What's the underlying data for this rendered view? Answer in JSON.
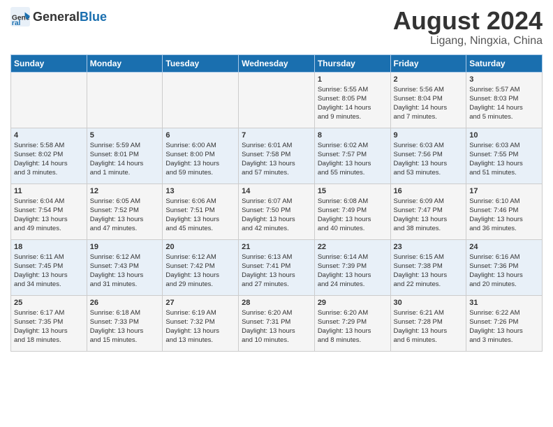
{
  "header": {
    "logo_general": "General",
    "logo_blue": "Blue",
    "month_year": "August 2024",
    "location": "Ligang, Ningxia, China"
  },
  "days_of_week": [
    "Sunday",
    "Monday",
    "Tuesday",
    "Wednesday",
    "Thursday",
    "Friday",
    "Saturday"
  ],
  "weeks": [
    [
      {
        "day": "",
        "info": ""
      },
      {
        "day": "",
        "info": ""
      },
      {
        "day": "",
        "info": ""
      },
      {
        "day": "",
        "info": ""
      },
      {
        "day": "1",
        "info": "Sunrise: 5:55 AM\nSunset: 8:05 PM\nDaylight: 14 hours\nand 9 minutes."
      },
      {
        "day": "2",
        "info": "Sunrise: 5:56 AM\nSunset: 8:04 PM\nDaylight: 14 hours\nand 7 minutes."
      },
      {
        "day": "3",
        "info": "Sunrise: 5:57 AM\nSunset: 8:03 PM\nDaylight: 14 hours\nand 5 minutes."
      }
    ],
    [
      {
        "day": "4",
        "info": "Sunrise: 5:58 AM\nSunset: 8:02 PM\nDaylight: 14 hours\nand 3 minutes."
      },
      {
        "day": "5",
        "info": "Sunrise: 5:59 AM\nSunset: 8:01 PM\nDaylight: 14 hours\nand 1 minute."
      },
      {
        "day": "6",
        "info": "Sunrise: 6:00 AM\nSunset: 8:00 PM\nDaylight: 13 hours\nand 59 minutes."
      },
      {
        "day": "7",
        "info": "Sunrise: 6:01 AM\nSunset: 7:58 PM\nDaylight: 13 hours\nand 57 minutes."
      },
      {
        "day": "8",
        "info": "Sunrise: 6:02 AM\nSunset: 7:57 PM\nDaylight: 13 hours\nand 55 minutes."
      },
      {
        "day": "9",
        "info": "Sunrise: 6:03 AM\nSunset: 7:56 PM\nDaylight: 13 hours\nand 53 minutes."
      },
      {
        "day": "10",
        "info": "Sunrise: 6:03 AM\nSunset: 7:55 PM\nDaylight: 13 hours\nand 51 minutes."
      }
    ],
    [
      {
        "day": "11",
        "info": "Sunrise: 6:04 AM\nSunset: 7:54 PM\nDaylight: 13 hours\nand 49 minutes."
      },
      {
        "day": "12",
        "info": "Sunrise: 6:05 AM\nSunset: 7:52 PM\nDaylight: 13 hours\nand 47 minutes."
      },
      {
        "day": "13",
        "info": "Sunrise: 6:06 AM\nSunset: 7:51 PM\nDaylight: 13 hours\nand 45 minutes."
      },
      {
        "day": "14",
        "info": "Sunrise: 6:07 AM\nSunset: 7:50 PM\nDaylight: 13 hours\nand 42 minutes."
      },
      {
        "day": "15",
        "info": "Sunrise: 6:08 AM\nSunset: 7:49 PM\nDaylight: 13 hours\nand 40 minutes."
      },
      {
        "day": "16",
        "info": "Sunrise: 6:09 AM\nSunset: 7:47 PM\nDaylight: 13 hours\nand 38 minutes."
      },
      {
        "day": "17",
        "info": "Sunrise: 6:10 AM\nSunset: 7:46 PM\nDaylight: 13 hours\nand 36 minutes."
      }
    ],
    [
      {
        "day": "18",
        "info": "Sunrise: 6:11 AM\nSunset: 7:45 PM\nDaylight: 13 hours\nand 34 minutes."
      },
      {
        "day": "19",
        "info": "Sunrise: 6:12 AM\nSunset: 7:43 PM\nDaylight: 13 hours\nand 31 minutes."
      },
      {
        "day": "20",
        "info": "Sunrise: 6:12 AM\nSunset: 7:42 PM\nDaylight: 13 hours\nand 29 minutes."
      },
      {
        "day": "21",
        "info": "Sunrise: 6:13 AM\nSunset: 7:41 PM\nDaylight: 13 hours\nand 27 minutes."
      },
      {
        "day": "22",
        "info": "Sunrise: 6:14 AM\nSunset: 7:39 PM\nDaylight: 13 hours\nand 24 minutes."
      },
      {
        "day": "23",
        "info": "Sunrise: 6:15 AM\nSunset: 7:38 PM\nDaylight: 13 hours\nand 22 minutes."
      },
      {
        "day": "24",
        "info": "Sunrise: 6:16 AM\nSunset: 7:36 PM\nDaylight: 13 hours\nand 20 minutes."
      }
    ],
    [
      {
        "day": "25",
        "info": "Sunrise: 6:17 AM\nSunset: 7:35 PM\nDaylight: 13 hours\nand 18 minutes."
      },
      {
        "day": "26",
        "info": "Sunrise: 6:18 AM\nSunset: 7:33 PM\nDaylight: 13 hours\nand 15 minutes."
      },
      {
        "day": "27",
        "info": "Sunrise: 6:19 AM\nSunset: 7:32 PM\nDaylight: 13 hours\nand 13 minutes."
      },
      {
        "day": "28",
        "info": "Sunrise: 6:20 AM\nSunset: 7:31 PM\nDaylight: 13 hours\nand 10 minutes."
      },
      {
        "day": "29",
        "info": "Sunrise: 6:20 AM\nSunset: 7:29 PM\nDaylight: 13 hours\nand 8 minutes."
      },
      {
        "day": "30",
        "info": "Sunrise: 6:21 AM\nSunset: 7:28 PM\nDaylight: 13 hours\nand 6 minutes."
      },
      {
        "day": "31",
        "info": "Sunrise: 6:22 AM\nSunset: 7:26 PM\nDaylight: 13 hours\nand 3 minutes."
      }
    ]
  ]
}
